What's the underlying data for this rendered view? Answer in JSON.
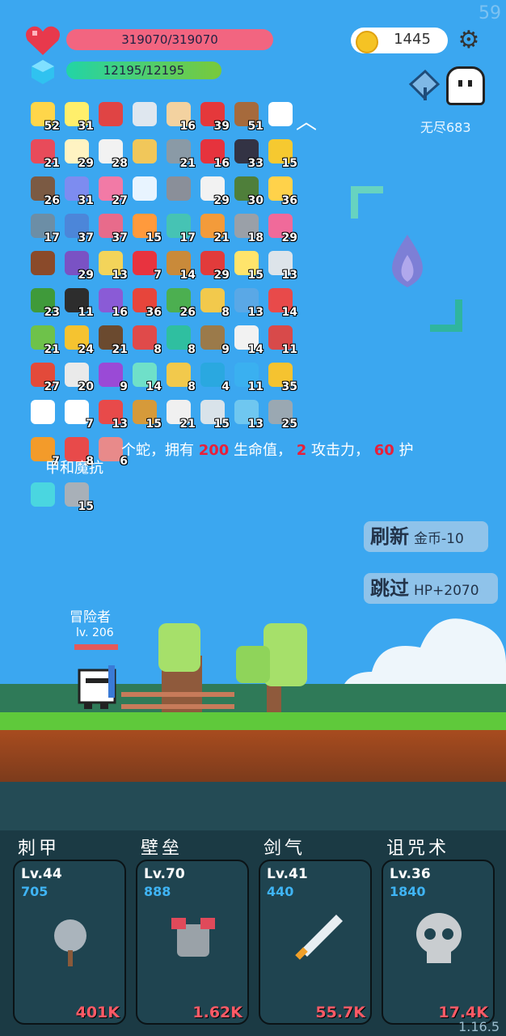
{
  "status": {
    "fps": "59",
    "version": "1.16.5"
  },
  "hp": {
    "text": "319070/319070"
  },
  "mp": {
    "text": "12195/12195"
  },
  "coins": "1445",
  "endless_label": "无尽683",
  "items": [
    {
      "n": "52",
      "c": "#ffd64a",
      "name": "star-card-icon"
    },
    {
      "n": "31",
      "c": "#ffef6b",
      "name": "lightbulb-icon"
    },
    {
      "n": "",
      "c": "#e04444",
      "name": "magnet-icon"
    },
    {
      "n": "",
      "c": "#dfe7ef",
      "name": "sword-icon"
    },
    {
      "n": "16",
      "c": "#f3d2a0",
      "name": "hand-icon"
    },
    {
      "n": "39",
      "c": "#e5383b",
      "name": "apple-icon"
    },
    {
      "n": "51",
      "c": "#a66a3c",
      "name": "target-board-icon"
    },
    {
      "n": "",
      "c": "#ffffff",
      "name": "question-mark-icon"
    },
    {
      "n": "21",
      "c": "#e84b5a",
      "name": "heart-icon"
    },
    {
      "n": "29",
      "c": "#fff3c2",
      "name": "egg-icon"
    },
    {
      "n": "28",
      "c": "#f2f2f2",
      "name": "clipboard-icon"
    },
    {
      "n": "",
      "c": "#f1c75a",
      "name": "map-icon"
    },
    {
      "n": "21",
      "c": "#8a9aa6",
      "name": "elephant-icon"
    },
    {
      "n": "16",
      "c": "#e6333d",
      "name": "strawberry-icon"
    },
    {
      "n": "33",
      "c": "#333344",
      "name": "bat-icon"
    },
    {
      "n": "15",
      "c": "#f6c930",
      "name": "sunflower-icon"
    },
    {
      "n": "26",
      "c": "#7b5a43",
      "name": "tombstone-icon"
    },
    {
      "n": "31",
      "c": "#7d8cf0",
      "name": "pill-icon"
    },
    {
      "n": "27",
      "c": "#f27aa6",
      "name": "potion-icon"
    },
    {
      "n": "",
      "c": "#e8f4ff",
      "name": "cloud-spirit-icon"
    },
    {
      "n": "",
      "c": "#8a8f99",
      "name": "helmet-icon"
    },
    {
      "n": "29",
      "c": "#f2f2f2",
      "name": "playing-card-icon"
    },
    {
      "n": "30",
      "c": "#4f7f3a",
      "name": "grenade-icon"
    },
    {
      "n": "36",
      "c": "#ffd24a",
      "name": "fried-egg-icon"
    },
    {
      "n": "17",
      "c": "#6c8ea6",
      "name": "compass-icon"
    },
    {
      "n": "37",
      "c": "#4c86d9",
      "name": "shield-icon"
    },
    {
      "n": "37",
      "c": "#e86b8b",
      "name": "jar-icon"
    },
    {
      "n": "15",
      "c": "#ff9a3c",
      "name": "meteor-icon"
    },
    {
      "n": "17",
      "c": "#46c3b4",
      "name": "ring-icon"
    },
    {
      "n": "21",
      "c": "#f39b3a",
      "name": "cone-flag-icon"
    },
    {
      "n": "18",
      "c": "#9aa0a8",
      "name": "spike-ball-icon"
    },
    {
      "n": "29",
      "c": "#f06a9a",
      "name": "ice-cream-icon"
    },
    {
      "n": "",
      "c": "#8a4a2a",
      "name": "mushroom-icon"
    },
    {
      "n": "29",
      "c": "#7a52c4",
      "name": "purple-shield-icon"
    },
    {
      "n": "13",
      "c": "#f3d45a",
      "name": "scroll-icon"
    },
    {
      "n": "7",
      "c": "#e8333f",
      "name": "broken-heart-icon"
    },
    {
      "n": "14",
      "c": "#c98a3a",
      "name": "bow-icon"
    },
    {
      "n": "29",
      "c": "#e23b3b",
      "name": "red-mushroom-icon"
    },
    {
      "n": "15",
      "c": "#ffe46b",
      "name": "halo-icon"
    },
    {
      "n": "13",
      "c": "#dde4ea",
      "name": "bunny-icon"
    },
    {
      "n": "23",
      "c": "#3f9a3a",
      "name": "turtle-icon"
    },
    {
      "n": "11",
      "c": "#2d2d2d",
      "name": "cauldron-icon"
    },
    {
      "n": "16",
      "c": "#8a5bd6",
      "name": "chest-icon"
    },
    {
      "n": "36",
      "c": "#e7453b",
      "name": "watermelon-icon"
    },
    {
      "n": "26",
      "c": "#4caf50",
      "name": "money-icon"
    },
    {
      "n": "8",
      "c": "#f2c94c",
      "name": "diamond-ring-icon"
    },
    {
      "n": "13",
      "c": "#5aa8e6",
      "name": "blue-scroll-icon"
    },
    {
      "n": "14",
      "c": "#e84a4a",
      "name": "capsule-icon"
    },
    {
      "n": "21",
      "c": "#6ec24a",
      "name": "zombie-icon"
    },
    {
      "n": "24",
      "c": "#f5c330",
      "name": "crown-icon"
    },
    {
      "n": "21",
      "c": "#6b4a2f",
      "name": "coconut-icon"
    },
    {
      "n": "8",
      "c": "#e04a4a",
      "name": "hook-icon"
    },
    {
      "n": "8",
      "c": "#2fbfa0",
      "name": "crosshair-icon"
    },
    {
      "n": "9",
      "c": "#9b7a4a",
      "name": "noose-icon"
    },
    {
      "n": "14",
      "c": "#f2f2f2",
      "name": "envelope-icon"
    },
    {
      "n": "11",
      "c": "#d84a4a",
      "name": "badge-shield-icon"
    },
    {
      "n": "27",
      "c": "#e34a3a",
      "name": "sock-icon"
    },
    {
      "n": "20",
      "c": "#eaeaea",
      "name": "dice-icon"
    },
    {
      "n": "9",
      "c": "#9a4ad6",
      "name": "crystal-ball-icon"
    },
    {
      "n": "14",
      "c": "#6fe0c9",
      "name": "slime-icon"
    },
    {
      "n": "8",
      "c": "#f2c94c",
      "name": "magic-wand-icon"
    },
    {
      "n": "4",
      "c": "#2aa8e0",
      "name": "sapphire-icon"
    },
    {
      "n": "11",
      "c": "#3ab0f0",
      "name": "chat-bubble-icon"
    },
    {
      "n": "35",
      "c": "#f5c330",
      "name": "coin-stack-icon"
    },
    {
      "n": "",
      "c": "#ffffff",
      "name": "speech-icon"
    },
    {
      "n": "7",
      "c": "#ffffff",
      "name": "ghost-icon"
    },
    {
      "n": "13",
      "c": "#e84a4a",
      "name": "gift-icon"
    },
    {
      "n": "15",
      "c": "#d69a3a",
      "name": "book-icon"
    },
    {
      "n": "21",
      "c": "#f0f0f0",
      "name": "cloud-icon"
    },
    {
      "n": "15",
      "c": "#d9e3ea",
      "name": "thermometer-icon"
    },
    {
      "n": "13",
      "c": "#6fc7f0",
      "name": "clock-icon"
    },
    {
      "n": "25",
      "c": "#9aa8b2",
      "name": "short-sword-icon"
    },
    {
      "n": "7",
      "c": "#f39b2a",
      "name": "yellow-scroll-icon"
    },
    {
      "n": "8",
      "c": "#e84a4a",
      "name": "bookmark-icon"
    },
    {
      "n": "6",
      "c": "#e88a8a",
      "name": "steak-icon"
    }
  ],
  "row2_items": [
    {
      "n": "",
      "c": "#4ad6e0",
      "name": "sparkle-icon"
    },
    {
      "n": "15",
      "c": "#a8b0b8",
      "name": "blade-icon"
    }
  ],
  "description": {
    "line1_pre": "个蛇，拥有 ",
    "hp_val": "200",
    "line1_mid": " 生命值， ",
    "atk_val": "2",
    "line1_mid2": " 攻击力， ",
    "def_val": "60",
    "line1_post": " 护",
    "line2": "甲和魔抗"
  },
  "refresh": {
    "label": "刷新",
    "cost": "金币-10"
  },
  "skip": {
    "label": "跳过",
    "reward": "HP+2070"
  },
  "hero": {
    "name": "冒险者",
    "level": "lv. 206"
  },
  "skills": [
    {
      "title": "刺甲",
      "lv": "Lv.44",
      "val": "705",
      "dmg": "401K",
      "icon": "spiked-mace-icon"
    },
    {
      "title": "壁垒",
      "lv": "Lv.70",
      "val": "888",
      "dmg": "1.62K",
      "icon": "armor-icon"
    },
    {
      "title": "剑气",
      "lv": "Lv.41",
      "val": "440",
      "dmg": "55.7K",
      "icon": "sword-qi-icon"
    },
    {
      "title": "诅咒术",
      "lv": "Lv.36",
      "val": "1840",
      "dmg": "17.4K",
      "icon": "skull-icon"
    }
  ]
}
